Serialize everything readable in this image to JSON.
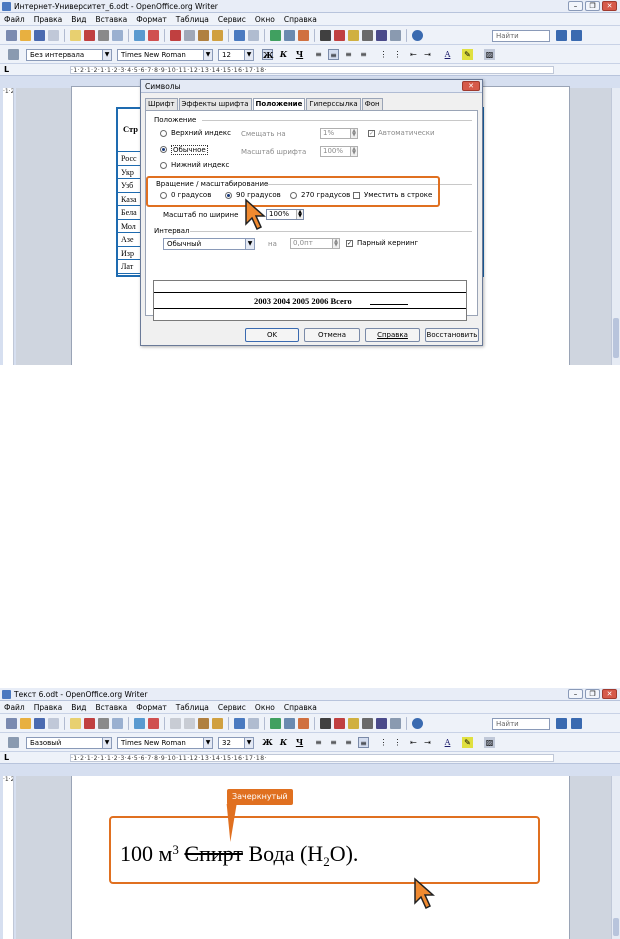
{
  "window1": {
    "title": "Интернет-Университет_6.odt - OpenOffice.org Writer",
    "menu": [
      "Файл",
      "Правка",
      "Вид",
      "Вставка",
      "Формат",
      "Таблица",
      "Сервис",
      "Окно",
      "Справка"
    ],
    "find_placeholder": "Найти",
    "style": "Без интервала",
    "font": "Times New Roman",
    "size": "12",
    "bold": "Ж",
    "italic": "К",
    "underline": "Ч",
    "ruler": "·1·2·1·2·1·1·2·3·4·5·6·7·8·9·10·11·12·13·14·15·16·17·18·",
    "table": {
      "header": "Стр",
      "rows": [
        "Росс",
        "Укр",
        "Узб",
        "Каза",
        "Бела",
        "Мол",
        "Азе",
        "Изр",
        "Лат"
      ]
    },
    "dialog": {
      "title": "Символы",
      "tabs": [
        "Шрифт",
        "Эффекты шрифта",
        "Положение",
        "Гиперссылка",
        "Фон"
      ],
      "position_group": "Положение",
      "superscript": "Верхний индекс",
      "normal": "Обычное",
      "subscript": "Нижний индекс",
      "raise_lower": "Смещать на",
      "raise_value": "1%",
      "auto": "Автоматически",
      "rel_size": "Масштаб шрифта",
      "rel_size_value": "100%",
      "rotation_group": "Вращение / масштабирование",
      "deg0": "0 градусов",
      "deg90": "90 градусов",
      "deg270": "270 градусов",
      "fit_line": "Уместить в строке",
      "scale_width": "Масштаб по ширине",
      "scale_width_value": "100%",
      "spacing_group": "Интервал",
      "spacing_value": "Обычный",
      "by": "на",
      "by_value": "0,0пт",
      "pair_kerning": "Парный кернинг",
      "preview_text": "2003 2004 2005 2006 Всего",
      "ok": "OK",
      "cancel": "Отмена",
      "help": "Справка",
      "reset": "Восстановить"
    }
  },
  "window2": {
    "title": "Текст 6.odt - OpenOffice.org Writer",
    "menu": [
      "Файл",
      "Правка",
      "Вид",
      "Вставка",
      "Формат",
      "Таблица",
      "Сервис",
      "Окно",
      "Справка"
    ],
    "find_placeholder": "Найти",
    "style": "Базовый",
    "font": "Times New Roman",
    "size": "32",
    "bold": "Ж",
    "italic": "К",
    "underline": "Ч",
    "ruler": "·1·2·1·2·1·1·2·3·4·5·6·7·8·9·10·11·12·13·14·15·16·17·18·",
    "callout": "Зачеркнутый",
    "text": {
      "t1": "100 м",
      "sup": "3",
      "strike": "Спирт",
      "t2": "Вода (Н",
      "sub": "2",
      "t3": "О)."
    }
  },
  "colors": {
    "accent": "#e07020",
    "table_border": "#1e6bb0"
  }
}
